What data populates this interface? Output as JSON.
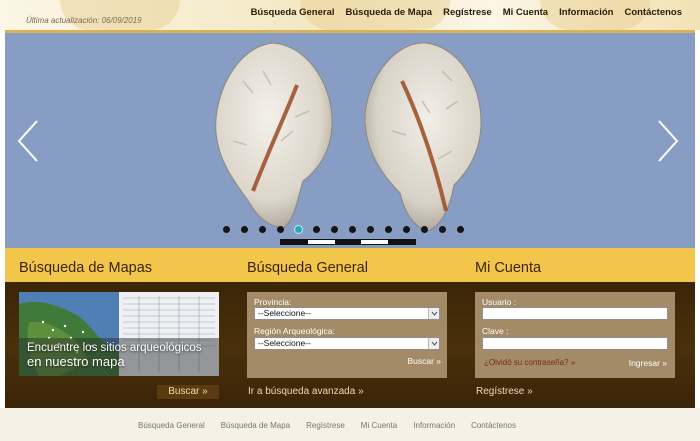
{
  "header": {
    "updated": "Última actualización: 06/09/2019",
    "nav": [
      "Búsqueda General",
      "Búsqueda de Mapa",
      "Regístrese",
      "Mi Cuenta",
      "Información",
      "Contáctenos"
    ]
  },
  "slider": {
    "dot_count": 14,
    "active_index": 4
  },
  "sections": {
    "map": {
      "title": "Búsqueda de Mapas",
      "caption_line1": "Encuentre los sitios arqueológicos",
      "caption_line2": "en nuestro mapa",
      "button": "Buscar »"
    },
    "general": {
      "title": "Búsqueda General",
      "provincia_label": "Provincia:",
      "provincia_value": "--Seleccione--",
      "region_label": "Región Arqueológica:",
      "region_value": "--Seleccione--",
      "search_link": "Buscar »",
      "advanced_link": "Ir a búsqueda avanzada »"
    },
    "account": {
      "title": "Mi Cuenta",
      "user_label": "Usuario :",
      "password_label": "Clave :",
      "forgot_link": "¿Olvidó su contraseña? »",
      "login_link": "Ingresar »",
      "register_link": "Regístrese »"
    }
  },
  "footer": {
    "nav": [
      "Búsqueda General",
      "Búsqueda de Mapa",
      "Regístrese",
      "Mi Cuenta",
      "Información",
      "Contáctenos"
    ]
  },
  "colors": {
    "section_yellow": "#f2c64a",
    "section_brown": "#3b2408",
    "hero_bg": "#889dc4",
    "active_dot": "#2aa8b8"
  }
}
